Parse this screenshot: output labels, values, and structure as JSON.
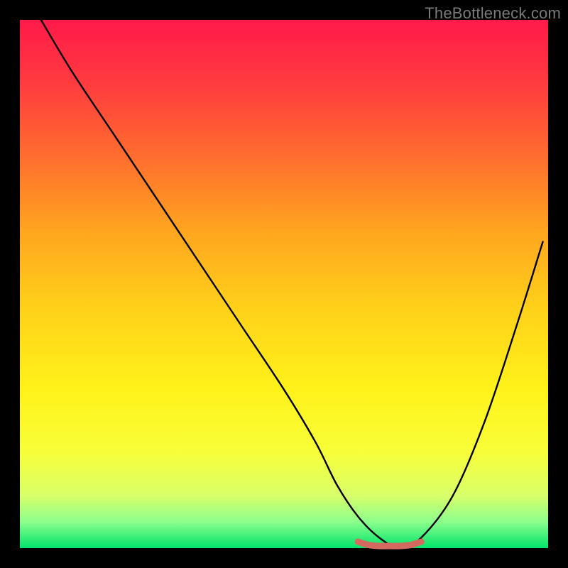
{
  "watermark": "TheBottleneck.com",
  "chart_data": {
    "type": "line",
    "title": "",
    "xlabel": "",
    "ylabel": "",
    "xlim": [
      0,
      100
    ],
    "ylim": [
      0,
      100
    ],
    "grid": false,
    "legend": false,
    "background_gradient": {
      "stops": [
        {
          "offset": 0.0,
          "color": "#ff1a4a"
        },
        {
          "offset": 0.12,
          "color": "#ff3b3f"
        },
        {
          "offset": 0.25,
          "color": "#ff6a2f"
        },
        {
          "offset": 0.4,
          "color": "#ffa51f"
        },
        {
          "offset": 0.55,
          "color": "#ffd21a"
        },
        {
          "offset": 0.7,
          "color": "#fff21a"
        },
        {
          "offset": 0.82,
          "color": "#f7ff3a"
        },
        {
          "offset": 0.9,
          "color": "#d9ff6a"
        },
        {
          "offset": 0.95,
          "color": "#8dff8d"
        },
        {
          "offset": 1.0,
          "color": "#00e36b"
        }
      ]
    },
    "series": [
      {
        "name": "bottleneck-curve",
        "stroke": "#000000",
        "x": [
          4,
          10,
          18,
          26,
          34,
          42,
          50,
          56,
          60,
          64,
          68,
          72,
          76,
          82,
          88,
          94,
          99
        ],
        "y": [
          100,
          90,
          78,
          66,
          54,
          42,
          30,
          20,
          12,
          6,
          2,
          0,
          2,
          10,
          24,
          42,
          58
        ]
      }
    ],
    "highlight_segment": {
      "name": "optimal-range",
      "stroke": "#d46a5f",
      "x": [
        64,
        66,
        68,
        70,
        72,
        74,
        76
      ],
      "y": [
        1.2,
        0.6,
        0.4,
        0.4,
        0.4,
        0.6,
        1.2
      ]
    }
  }
}
